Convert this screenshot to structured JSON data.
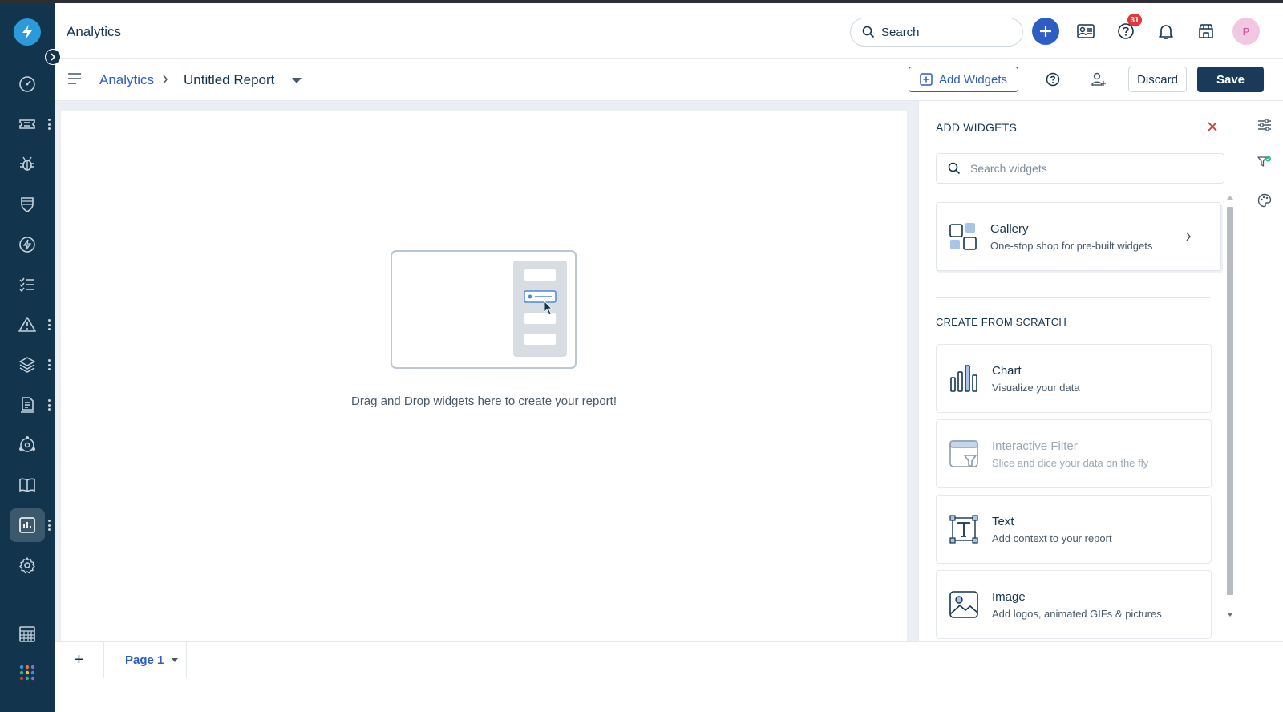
{
  "header": {
    "app_title": "Analytics",
    "search_label": "Search",
    "help_badge_count": "31",
    "avatar_initial": "P"
  },
  "breadcrumb": {
    "root": "Analytics",
    "current": "Untitled Report"
  },
  "toolbar": {
    "add_widgets_label": "Add Widgets",
    "discard_label": "Discard",
    "save_label": "Save"
  },
  "canvas": {
    "empty_message": "Drag and Drop widgets here to create your report!"
  },
  "widget_panel": {
    "title": "ADD WIDGETS",
    "search_placeholder": "Search widgets",
    "gallery": {
      "title": "Gallery",
      "subtitle": "One-stop shop for pre-built widgets"
    },
    "section_title": "CREATE FROM SCRATCH",
    "widgets": [
      {
        "title": "Chart",
        "subtitle": "Visualize your data",
        "icon": "bar-chart-icon",
        "enabled": true
      },
      {
        "title": "Interactive Filter",
        "subtitle": "Slice and dice your data on the fly",
        "icon": "filter-icon",
        "enabled": false
      },
      {
        "title": "Text",
        "subtitle": "Add context to your report",
        "icon": "text-icon",
        "enabled": true
      },
      {
        "title": "Image",
        "subtitle": "Add logos, animated GIFs & pictures",
        "icon": "image-icon",
        "enabled": true
      }
    ]
  },
  "pages": {
    "add_label": "+",
    "tabs": [
      {
        "label": "Page 1"
      }
    ]
  },
  "colors": {
    "nav_bg": "#12344d",
    "brand_blue": "#2c5cc5",
    "save_bg": "#1a3a5a",
    "badge_red": "#e43538"
  }
}
